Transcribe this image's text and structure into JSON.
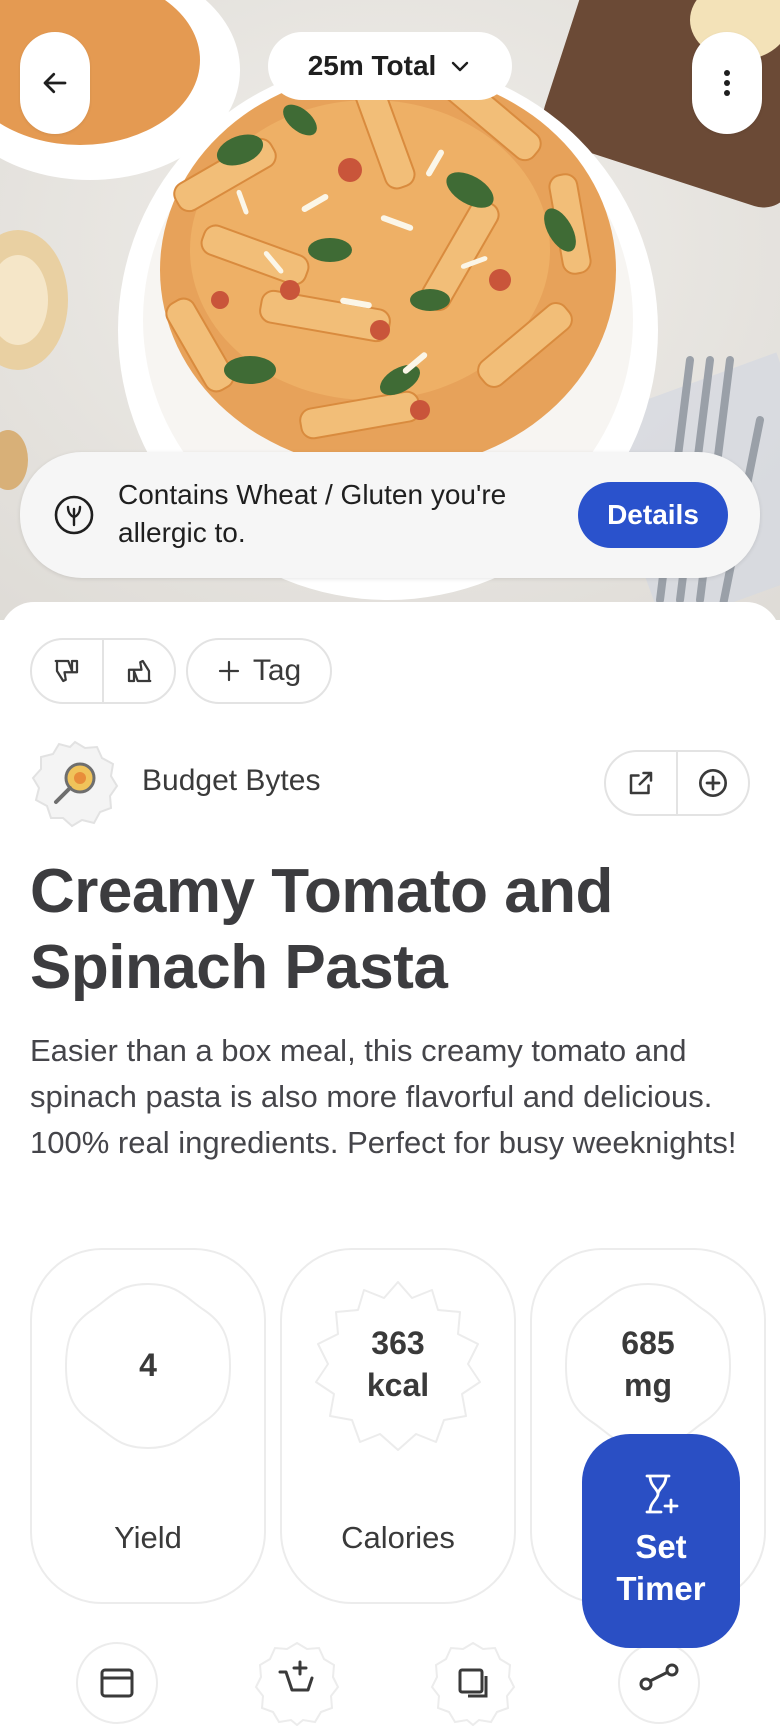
{
  "header": {
    "time_pill": "25m Total"
  },
  "allergy_banner": {
    "message": "Contains Wheat / Gluten you're allergic to.",
    "details_label": "Details"
  },
  "tag_button": {
    "label": "Tag"
  },
  "source": {
    "name": "Budget Bytes"
  },
  "recipe": {
    "title": "Creamy Tomato and Spinach Pasta",
    "description": "Easier than a box meal, this creamy tomato and spinach pasta is also more flavorful and delicious. 100% real ingredients. Perfect for busy weeknights!"
  },
  "stats": [
    {
      "value": "4",
      "label": "Yield"
    },
    {
      "value": "363\nkcal",
      "label": "Calories"
    },
    {
      "value": "685\nmg",
      "label": ""
    }
  ],
  "fab": {
    "label": "Set\nTimer"
  },
  "icons": {
    "back": "arrow-left-icon",
    "more": "more-vert-icon",
    "chevron": "chevron-down-icon",
    "allergy": "wheat-icon",
    "dislike": "thumbs-down-icon",
    "like": "thumbs-up-icon",
    "add": "plus-icon",
    "open": "open-external-icon",
    "add_circle": "add-circle-icon",
    "timer": "hourglass-add-icon"
  },
  "colors": {
    "accent": "#2a52cc",
    "fab": "#2a4fc4",
    "text": "#3c3c3f"
  }
}
